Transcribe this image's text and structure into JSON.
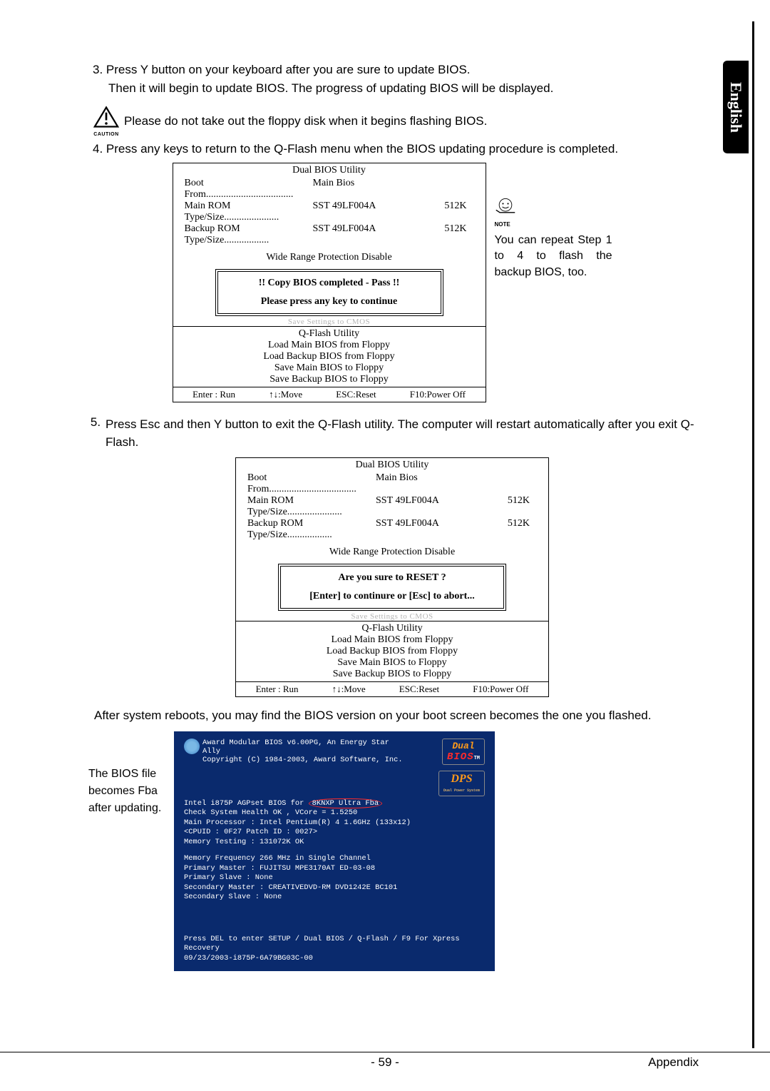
{
  "side_tab": "English",
  "step3": {
    "line1": "3. Press Y button on your keyboard after you are sure to update BIOS.",
    "line2": "Then it will begin to update BIOS. The progress of updating BIOS will be displayed."
  },
  "caution_label": "CAUTION",
  "caution_text": "Please do not take out the floppy disk when it begins flashing BIOS.",
  "step4": "4. Press any keys to return to the Q-Flash menu when the BIOS updating procedure is completed.",
  "bios_box": {
    "title": "Dual BIOS Utility",
    "boot_from_label": "Boot From",
    "boot_from_value": "Main Bios",
    "main_rom_label": "Main ROM Type/Size",
    "main_rom_value": "SST 49LF004A",
    "main_rom_size": "512K",
    "backup_rom_label": "Backup ROM Type/Size",
    "backup_rom_value": "SST 49LF004A",
    "backup_rom_size": "512K",
    "wide_range": "Wide Range Protection     Disable",
    "qflash_title": "Q-Flash Utility",
    "items": [
      "Load Main BIOS from Floppy",
      "Load Backup BIOS from Floppy",
      "Save Main BIOS to Floppy",
      "Save Backup BIOS to Floppy"
    ],
    "footer": [
      "Enter : Run",
      "↑↓:Move",
      "ESC:Reset",
      "F10:Power Off"
    ],
    "blurred": "Save Settings to CMOS"
  },
  "inner1": {
    "line1": "!! Copy BIOS completed - Pass !!",
    "line2": "Please press any key to continue"
  },
  "note_label": "NOTE",
  "note_text": "You can repeat Step 1 to 4 to flash the backup BIOS, too.",
  "step5": {
    "num": "5.",
    "text": "Press Esc and then Y button to exit the Q-Flash utility. The computer will restart automatically after you exit Q-Flash."
  },
  "inner2": {
    "line1": "Are you sure to RESET ?",
    "line2": "[Enter] to continure or [Esc] to abort..."
  },
  "after_reboot": "After system reboots, you may find the BIOS version on your boot screen becomes the one you flashed.",
  "boot_annot": "The BIOS file becomes Fba after updating.",
  "boot": {
    "hdr1": "Award Modular BIOS v6.00PG, An Energy Star Ally",
    "hdr2": "Copyright (C) 1984-2003, Award Software, Inc.",
    "info1_a": "Intel i875P AGPset BIOS for",
    "info1_circled": "8KNXP Ultra Fba",
    "info1_b": "Check System Health OK , VCore = 1.5250",
    "info1_c": "Main Processor : Intel Pentium(R) 4  1.6GHz (133x12)",
    "info1_d": "<CPUID : 0F27 Patch ID : 0027>",
    "info1_e": "Memory Testing  : 131072K OK",
    "info2_a": "Memory Frequency 266 MHz in Single Channel",
    "info2_b": "Primary Master : FUJITSU MPE3170AT ED-03-08",
    "info2_c": "Primary Slave : None",
    "info2_d": "Secondary Master : CREATIVEDVD-RM DVD1242E BC101",
    "info2_e": "Secondary Slave : None",
    "ftr1": "Press DEL to enter SETUP / Dual BIOS / Q-Flash / F9 For Xpress Recovery",
    "ftr2": "09/23/2003-i875P-6A79BG03C-00",
    "logo1_d": "Dual",
    "logo1_b": "BIOS",
    "logo1_tm": "TM",
    "logo2_dp": "DPS",
    "logo2_sub": "Dual Power System"
  },
  "footer": {
    "page": "- 59 -",
    "section": "Appendix"
  }
}
